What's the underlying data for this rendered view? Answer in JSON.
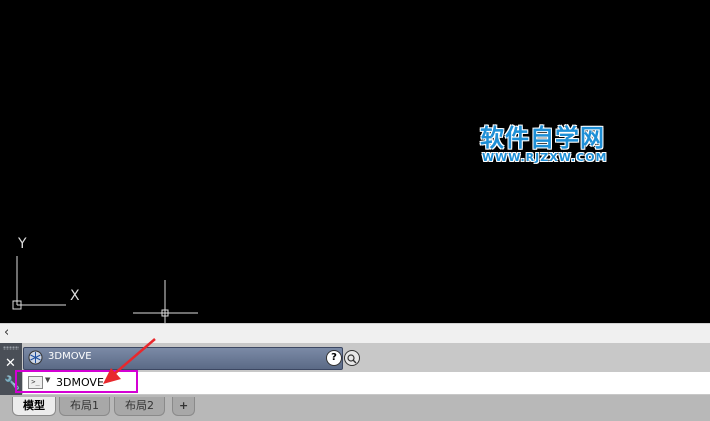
{
  "watermark": {
    "title": "软件自学网",
    "url": "WWW.RJZXW.COM"
  },
  "ucs": {
    "y_label": "Y",
    "x_label": "X"
  },
  "command_history": {
    "text": "3DMOVE",
    "help_label": "?"
  },
  "command_line": {
    "prompt_label": ">_",
    "value": "3DMOVE"
  },
  "tabs": [
    {
      "label": "模型",
      "active": true
    },
    {
      "label": "布局1",
      "active": false
    },
    {
      "label": "布局2",
      "active": false
    },
    {
      "label": "+",
      "active": false
    }
  ],
  "colors": {
    "canvas_bg": "#000000",
    "highlight_box": "#d400d4",
    "annotation_arrow": "#e8282d",
    "watermark": "#1e8fd6"
  },
  "icons": {
    "scroll_left": "chevron-left-icon",
    "close": "close-icon",
    "customize": "wrench-icon",
    "command_icon": "3dmove-icon",
    "help": "help-icon",
    "search": "search-icon"
  }
}
